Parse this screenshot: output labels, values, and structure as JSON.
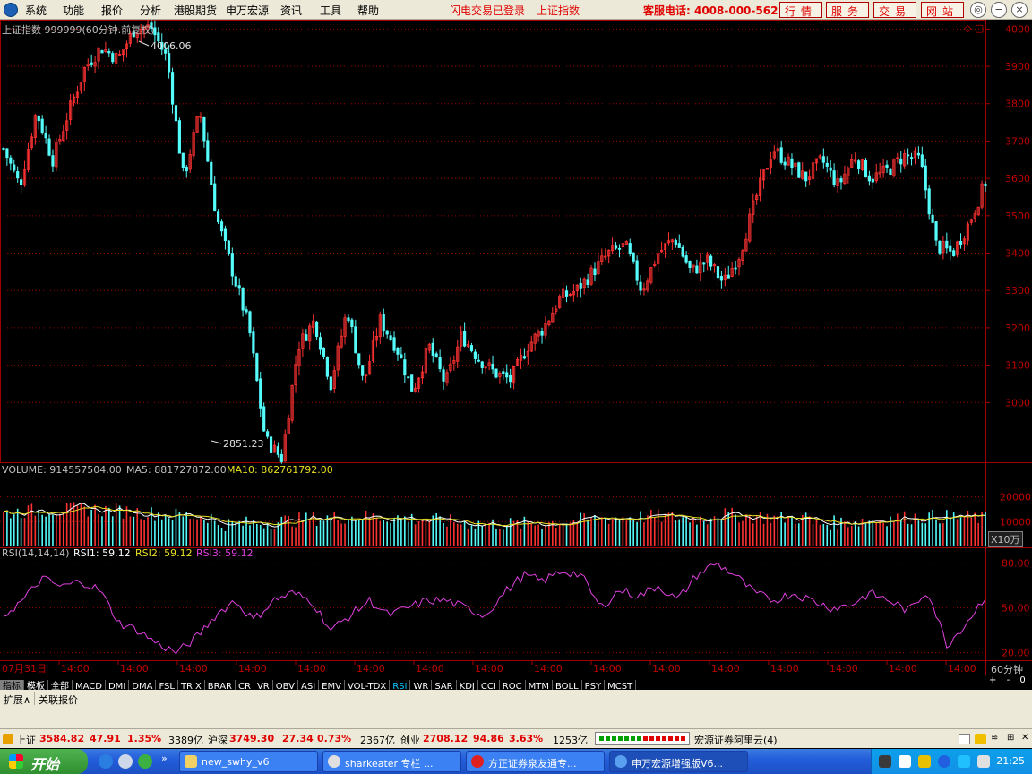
{
  "menu": {
    "items": [
      "系统",
      "功能",
      "报价",
      "分析",
      "港股期货",
      "申万宏源",
      "资讯",
      "工具",
      "帮助"
    ],
    "flash_status": "闪电交易已登录",
    "current_index": "上证指数",
    "hotline": "客服电话: 4008-000-562",
    "nav_buttons": [
      "行情",
      "服务",
      "交易",
      "网站"
    ]
  },
  "main_chart": {
    "title": "上证指数 999999(60分钟.前复权)",
    "high_label": "4006.06",
    "low_label": "2851.23"
  },
  "volume": {
    "label": "VOLUME: 914557504.00",
    "ma5_label": "MA5: 881727872.00",
    "ma10_label": "MA10: 862761792.00",
    "unit": "X10万"
  },
  "rsi": {
    "label": "RSI(14,14,14)",
    "rsi1": "RSI1: 59.12",
    "rsi2": "RSI2: 59.12",
    "rsi3": "RSI3: 59.12"
  },
  "time_axis": {
    "first": "07月31日",
    "tick": "14:00",
    "period": "60分钟",
    "controls": [
      "+",
      "-",
      "0"
    ]
  },
  "indicator_tabs": [
    "指标",
    "模板",
    "全部",
    "MACD",
    "DMI",
    "DMA",
    "FSL",
    "TRIX",
    "BRAR",
    "CR",
    "VR",
    "OBV",
    "ASI",
    "EMV",
    "VOL-TDX",
    "RSI",
    "WR",
    "SAR",
    "KDJ",
    "CCI",
    "ROC",
    "MTM",
    "BOLL",
    "PSY",
    "MCST"
  ],
  "active_tab": "RSI",
  "sub_tabs": [
    "扩展∧",
    "关联报价"
  ],
  "status": {
    "sh_label": "上证",
    "sh_value": "3584.82",
    "sh_change": "47.91",
    "sh_pct": "1.35%",
    "sh_amount": "3389亿",
    "hs_label": "沪深",
    "hs_value": "3749.30",
    "hs_change": "27.34",
    "hs_pct": "0.73%",
    "hs_amount": "2367亿",
    "cy_label": "创业",
    "cy_value": "2708.12",
    "cy_change": "94.86",
    "cy_pct": "3.63%",
    "cy_amount": "1253亿",
    "server": "宏源证券阿里云(4)"
  },
  "taskbar": {
    "start": "开始",
    "tasks": [
      "new_swhy_v6",
      "sharkeater 专栏 ...",
      "方正证券泉友通专...",
      "申万宏源增强版V6..."
    ],
    "clock": "21:25"
  },
  "chart_data": [
    {
      "type": "candlestick",
      "title": "上证指数 999999(60分钟.前复权)",
      "y_ticks": [
        3000,
        3100,
        3200,
        3300,
        3400,
        3500,
        3600,
        3700,
        3800,
        3900,
        4000
      ],
      "ylim": [
        2840,
        4020
      ],
      "annotations": [
        {
          "text": "4006.06",
          "value": 4006.06
        },
        {
          "text": "2851.23",
          "value": 2851.23
        }
      ],
      "anchors": [
        3680,
        3580,
        3780,
        3650,
        3780,
        3900,
        3950,
        3920,
        4000,
        4006,
        3920,
        3600,
        3780,
        3500,
        3350,
        3200,
        2900,
        2851,
        3150,
        3220,
        3050,
        3250,
        3050,
        3220,
        3150,
        3030,
        3150,
        3050,
        3180,
        3120,
        3080,
        3060,
        3150,
        3200,
        3280,
        3300,
        3350,
        3400,
        3420,
        3300,
        3400,
        3440,
        3350,
        3380,
        3320,
        3400,
        3550,
        3680,
        3640,
        3600,
        3650,
        3580,
        3660,
        3600,
        3620,
        3660,
        3650,
        3420,
        3400,
        3480,
        3590
      ],
      "grid": "dotted-red"
    },
    {
      "type": "bar",
      "title": "VOLUME",
      "y_ticks": [
        10000,
        20000
      ],
      "unit": "X10万",
      "series": [
        "VOLUME",
        "MA5",
        "MA10"
      ]
    },
    {
      "type": "line",
      "title": "RSI(14,14,14)",
      "y_ticks": [
        20,
        50,
        80
      ],
      "anchors": [
        45,
        55,
        70,
        64,
        68,
        62,
        40,
        35,
        26,
        20,
        30,
        45,
        55,
        42,
        55,
        60,
        55,
        35,
        45,
        55,
        45,
        50,
        55,
        55,
        50,
        45,
        60,
        72,
        68,
        75,
        72,
        50,
        62,
        58,
        65,
        55,
        72,
        80,
        72,
        60,
        55,
        60,
        55,
        50,
        52,
        60,
        55,
        48,
        62,
        25,
        40,
        58
      ]
    }
  ]
}
